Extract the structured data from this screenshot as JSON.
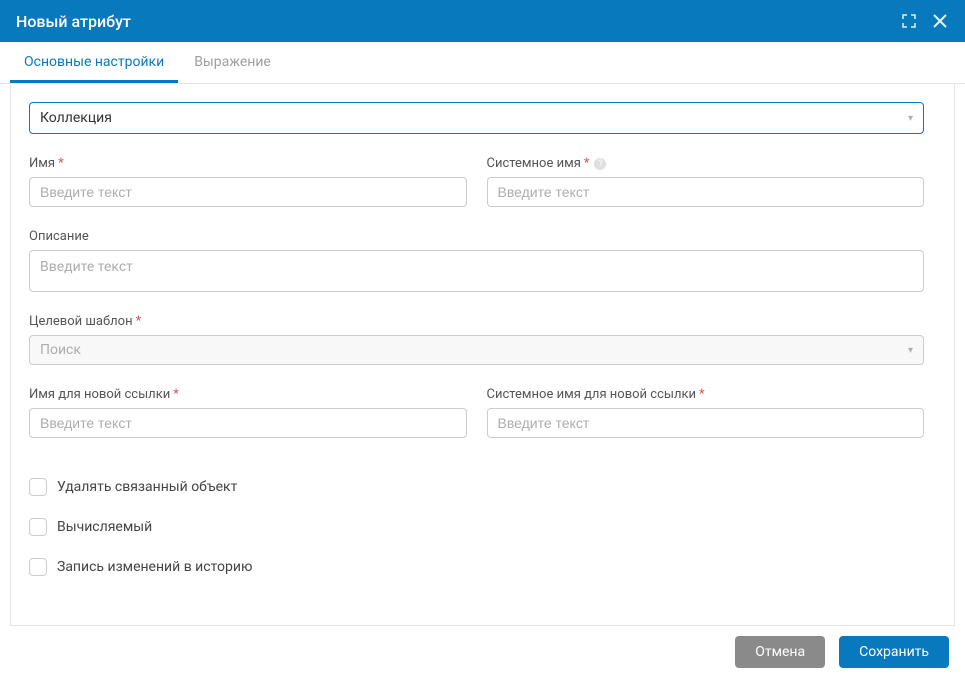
{
  "header": {
    "title": "Новый атрибут"
  },
  "tabs": {
    "main": "Основные настройки",
    "expr": "Выражение"
  },
  "main_select": {
    "value": "Коллекция"
  },
  "fields": {
    "name": {
      "label": "Имя",
      "placeholder": "Введите текст"
    },
    "sysname": {
      "label": "Системное имя",
      "placeholder": "Введите текст"
    },
    "desc": {
      "label": "Описание",
      "placeholder": "Введите текст"
    },
    "target": {
      "label": "Целевой шаблон",
      "placeholder": "Поиск"
    },
    "linkname": {
      "label": "Имя для новой ссылки",
      "placeholder": "Введите текст"
    },
    "linksys": {
      "label": "Системное имя для новой ссылки",
      "placeholder": "Введите текст"
    }
  },
  "checkboxes": {
    "delete_related": "Удалять связанный объект",
    "computed": "Вычисляемый",
    "audit": "Запись изменений в историю"
  },
  "footer": {
    "cancel": "Отмена",
    "save": "Сохранить"
  }
}
